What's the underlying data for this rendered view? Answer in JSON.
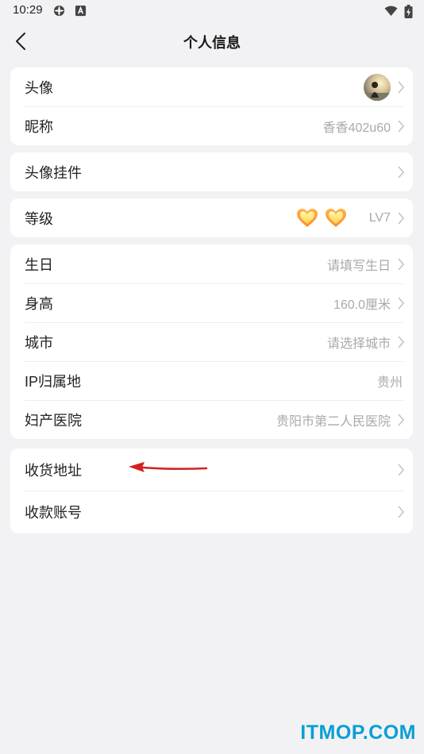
{
  "status_bar": {
    "time": "10:29"
  },
  "header": {
    "title": "个人信息"
  },
  "sections": [
    {
      "rows": [
        {
          "label": "头像",
          "value": ""
        },
        {
          "label": "昵称",
          "value": "香香402u60"
        }
      ]
    },
    {
      "rows": [
        {
          "label": "头像挂件",
          "value": ""
        }
      ]
    },
    {
      "rows": [
        {
          "label": "等级",
          "value": "LV7"
        }
      ]
    },
    {
      "rows": [
        {
          "label": "生日",
          "value": "请填写生日"
        },
        {
          "label": "身高",
          "value": "160.0厘米"
        },
        {
          "label": "城市",
          "value": "请选择城市"
        },
        {
          "label": "IP归属地",
          "value": "贵州"
        },
        {
          "label": "妇产医院",
          "value": "贵阳市第二人民医院"
        }
      ]
    },
    {
      "rows": [
        {
          "label": "收货地址",
          "value": ""
        },
        {
          "label": "收款账号",
          "value": ""
        }
      ]
    }
  ],
  "watermark": "ITMOP.COM",
  "colors": {
    "background": "#f2f2f4",
    "hint": "#a9a9a9",
    "watermark": "#0a9fd4",
    "arrow": "#d42020"
  }
}
